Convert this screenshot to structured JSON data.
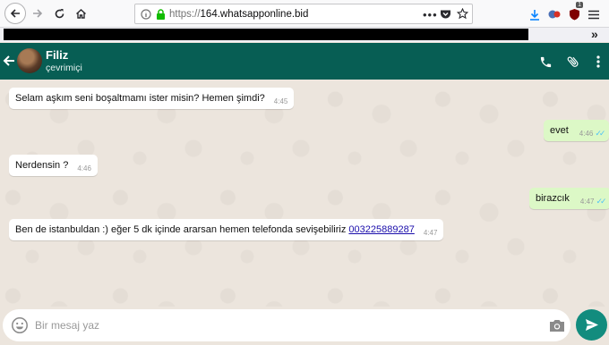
{
  "browser": {
    "url_scheme": "https://",
    "url_host": "164.whatsapponline.bid",
    "addon_badge": "1",
    "more_label": "»"
  },
  "header": {
    "contact_name": "Filiz",
    "contact_status": "çevrimiçi"
  },
  "messages": [
    {
      "dir": "in",
      "text": "Selam aşkım seni boşaltmamı ister misin? Hemen şimdi?",
      "time": "4:45"
    },
    {
      "dir": "out",
      "text": "evet",
      "time": "4:46"
    },
    {
      "dir": "in",
      "text": "Nerdensin ?",
      "time": "4:46"
    },
    {
      "dir": "out",
      "text": "birazcık",
      "time": "4:47"
    },
    {
      "dir": "in",
      "text": "Ben de istanbuldan :) eğer 5 dk içinde ararsan hemen telefonda sevişebiliriz",
      "link": "003225889287",
      "time": "4:47"
    }
  ],
  "composer": {
    "placeholder": "Bir mesaj yaz"
  },
  "colors": {
    "header": "#075e54",
    "chat_bg": "#ece5dd",
    "outgoing": "#dcf8c6",
    "send": "#128c7e"
  }
}
